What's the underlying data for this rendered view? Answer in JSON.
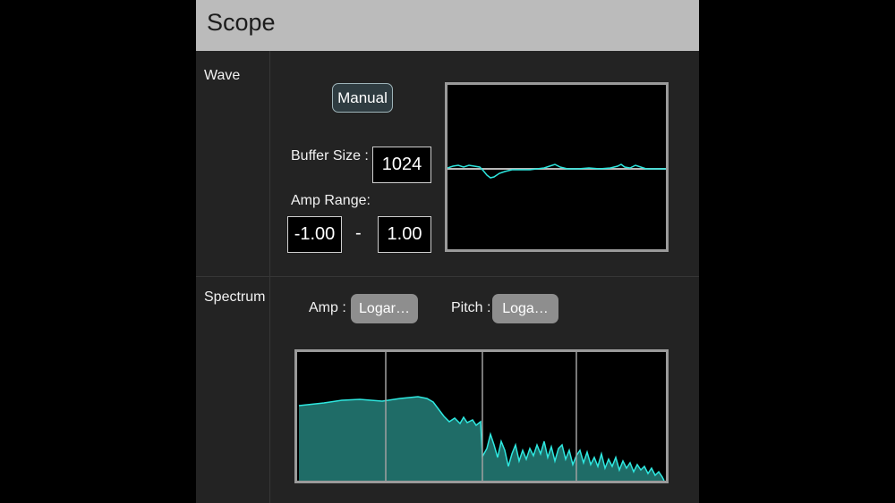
{
  "panel": {
    "title": "Scope"
  },
  "wave": {
    "section_label": "Wave",
    "manual_button_label": "Manual",
    "buffer_size_label": "Buffer Size :",
    "buffer_size_value": "1024",
    "amp_range_label": "Amp Range:",
    "amp_range_min": "-1.00",
    "amp_range_separator": "-",
    "amp_range_max": "1.00"
  },
  "spectrum": {
    "section_label": "Spectrum",
    "amp_label": "Amp :",
    "amp_scale_value": "Logar…",
    "pitch_label": "Pitch :",
    "pitch_scale_value": "Loga…"
  },
  "colors": {
    "trace": "#2ee8e0",
    "spectrum_fill": "#1f6c67",
    "baseline": "#b8b8b8",
    "grid": "#a0a0a0"
  }
}
